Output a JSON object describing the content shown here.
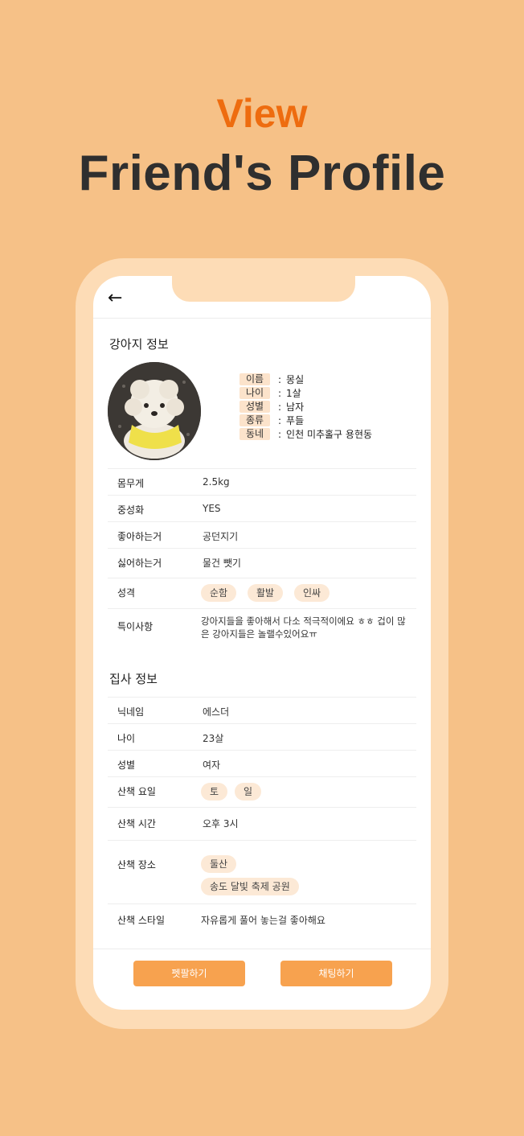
{
  "hero": {
    "subtitle": "View",
    "title": "Friend's Profile"
  },
  "nav": {
    "back_icon": "←"
  },
  "dog": {
    "section_title": "강아지 정보",
    "summary": [
      {
        "label": "이름",
        "value": "몽실"
      },
      {
        "label": "나이",
        "value": "1살"
      },
      {
        "label": "성별",
        "value": "남자"
      },
      {
        "label": "종류",
        "value": "푸들"
      },
      {
        "label": "동네",
        "value": "인천 미추홀구 용현동"
      }
    ],
    "weight_label": "몸무게",
    "weight_value": "2.5kg",
    "neutered_label": "중성화",
    "neutered_value": "YES",
    "likes_label": "좋아하는거",
    "likes_value": "공던지기",
    "dislikes_label": "싫어하는거",
    "dislikes_value": "물건 뺏기",
    "personality_label": "성격",
    "personality": [
      "순함",
      "활발",
      "인싸"
    ],
    "notes_label": "특이사항",
    "notes_value": "강아지들을 좋아해서 다소 적극적이에요 ㅎㅎ 겁이 많은 강아지들은 놀랠수있어요ㅠ"
  },
  "owner": {
    "section_title": "집사 정보",
    "nickname_label": "닉네임",
    "nickname_value": "에스더",
    "age_label": "나이",
    "age_value": "23살",
    "gender_label": "성별",
    "gender_value": "여자",
    "walk_days_label": "산책 요일",
    "walk_days": [
      "토",
      "일"
    ],
    "walk_time_label": "산책 시간",
    "walk_time_value": "오후 3시",
    "walk_place_label": "산책 장소",
    "walk_places": [
      "둘산",
      "송도 달빛 축제 공원"
    ],
    "walk_style_label": "산책 스타일",
    "walk_style_value": "자유롭게 풀어 놓는걸 좋아해요"
  },
  "actions": {
    "friend_label": "펫팔하기",
    "chat_label": "채팅하기"
  },
  "colors": {
    "background": "#F6C187",
    "accent": "#EE6C0F",
    "button": "#F7A24F",
    "chip": "#FCE9D6"
  }
}
